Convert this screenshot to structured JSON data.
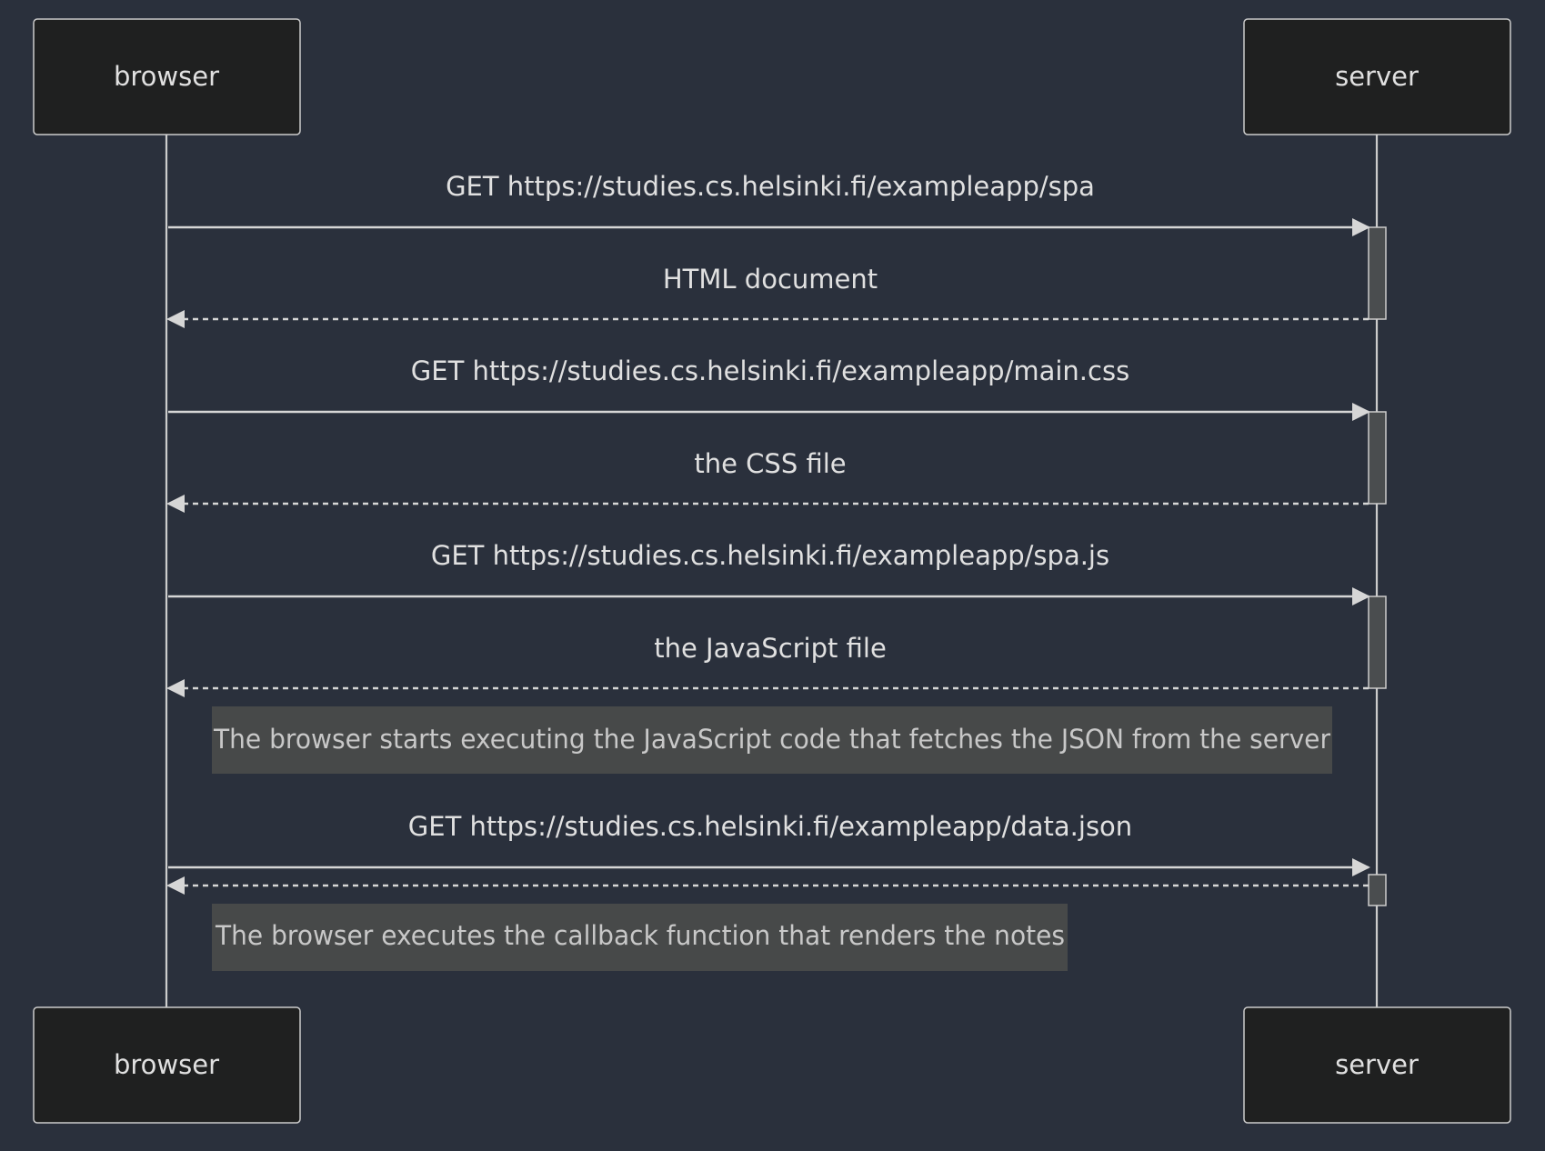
{
  "participants": {
    "browser": "browser",
    "server": "server"
  },
  "messages": [
    {
      "label": "GET https://studies.cs.helsinki.fi/exampleapp/spa",
      "from": "browser",
      "to": "server",
      "style": "solid"
    },
    {
      "label": "HTML document",
      "from": "server",
      "to": "browser",
      "style": "dashed"
    },
    {
      "label": "GET https://studies.cs.helsinki.fi/exampleapp/main.css",
      "from": "browser",
      "to": "server",
      "style": "solid"
    },
    {
      "label": "the CSS file",
      "from": "server",
      "to": "browser",
      "style": "dashed"
    },
    {
      "label": "GET https://studies.cs.helsinki.fi/exampleapp/spa.js",
      "from": "browser",
      "to": "server",
      "style": "solid"
    },
    {
      "label": "the JavaScript file",
      "from": "server",
      "to": "browser",
      "style": "dashed"
    },
    {
      "label": "GET https://studies.cs.helsinki.fi/exampleapp/data.json",
      "from": "browser",
      "to": "server",
      "style": "solid"
    },
    {
      "label": "",
      "from": "server",
      "to": "browser",
      "style": "dashed"
    }
  ],
  "notes": [
    "The browser starts executing the JavaScript code that fetches the JSON from the server",
    "The browser executes the callback function that renders the notes"
  ],
  "colors": {
    "background": "#2a303c",
    "actor_fill": "#1f2020",
    "line": "#cccccc",
    "activation_fill": "#4a4d4f",
    "note_fill": "#474949"
  }
}
